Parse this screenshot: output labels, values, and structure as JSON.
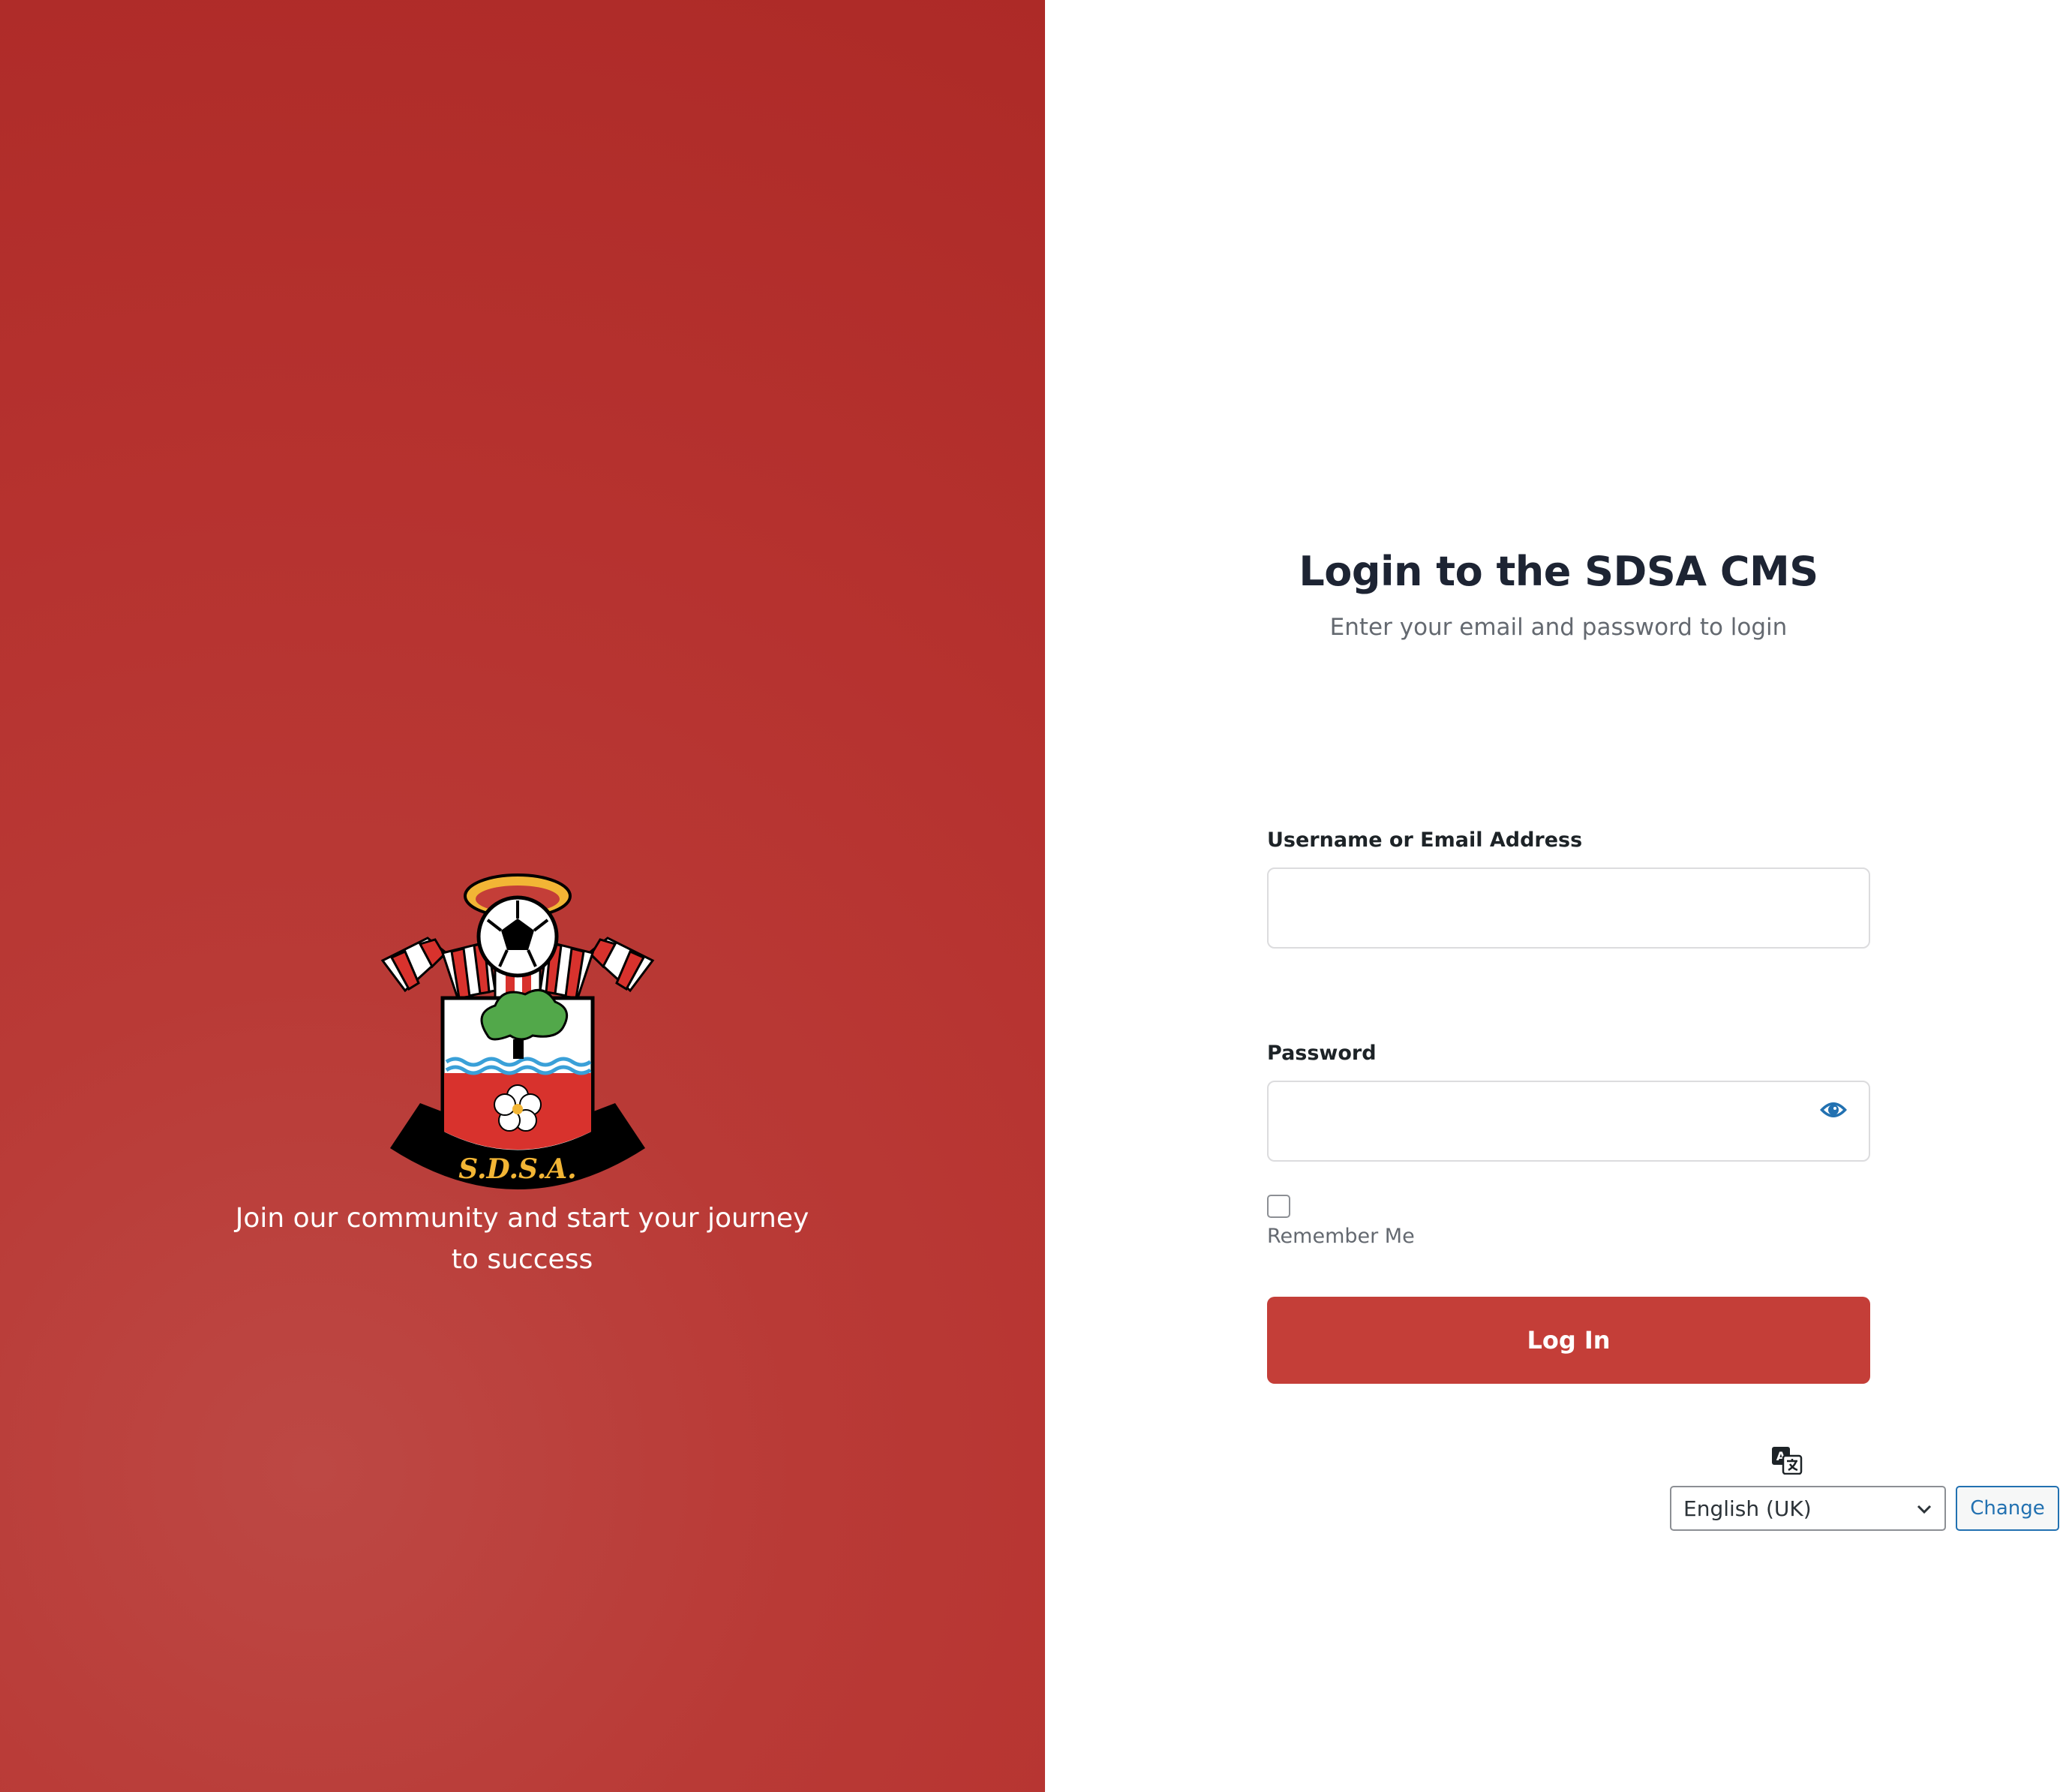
{
  "brand": {
    "crest_text": "S.D.S.A.",
    "tagline": "Join our community and start your journey to success"
  },
  "login": {
    "title": "Login to the SDSA CMS",
    "subtitle": "Enter your email and password to login",
    "username_label": "Username or Email Address",
    "username_value": "",
    "password_label": "Password",
    "password_value": "",
    "remember_label": "Remember Me",
    "remember_checked": false,
    "submit_label": "Log In"
  },
  "language": {
    "selected": "English (UK)",
    "change_label": "Change"
  },
  "colors": {
    "brand_red": "#c43e38",
    "link_blue": "#2271b1"
  },
  "icons": {
    "password_toggle": "eye-icon",
    "language": "translate-icon",
    "select_arrow": "chevron-down-icon"
  }
}
